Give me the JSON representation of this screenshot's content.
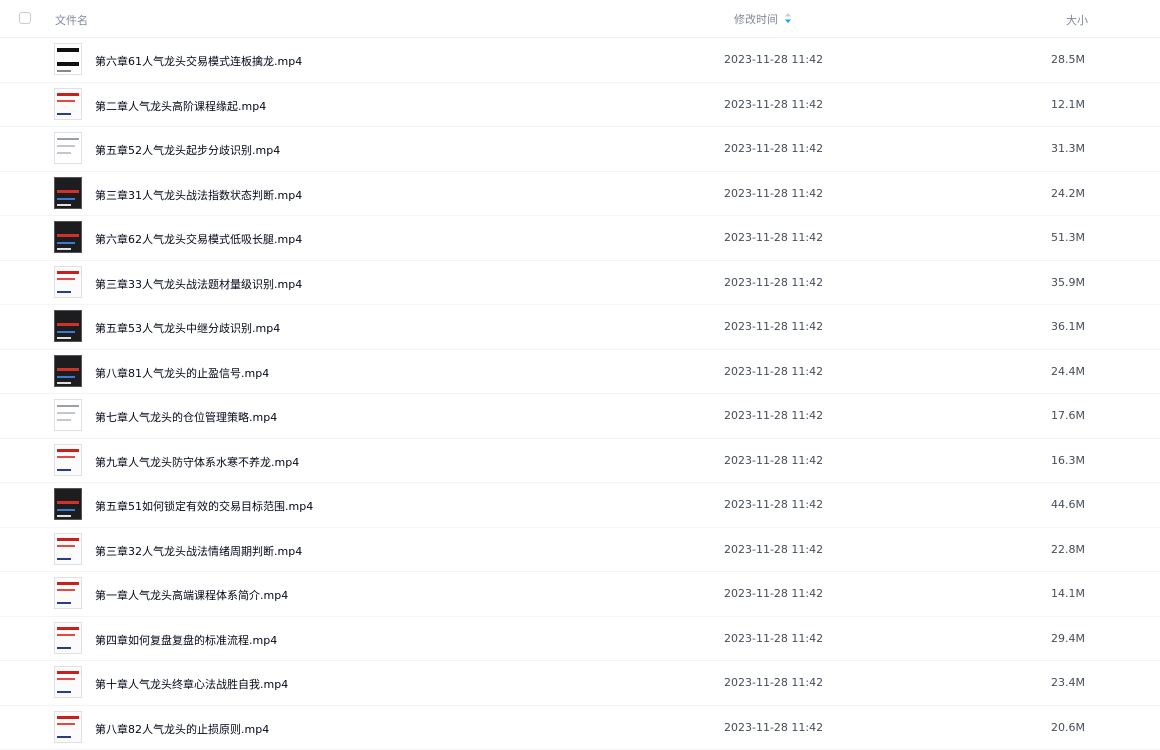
{
  "header": {
    "name_label": "文件名",
    "time_label": "修改时间",
    "size_label": "大小",
    "sort_icon": "sort-desc-icon",
    "accent": "#06a7ff"
  },
  "files": [
    {
      "name": "第六章61人气龙头交易模式连板擒龙.mp4",
      "time": "2023-11-28 11:42",
      "size": "28.5M",
      "thumb": "mixed"
    },
    {
      "name": "第二章人气龙头高阶课程缘起.mp4",
      "time": "2023-11-28 11:42",
      "size": "12.1M",
      "thumb": "red"
    },
    {
      "name": "第五章52人气龙头起步分歧识别.mp4",
      "time": "2023-11-28 11:42",
      "size": "31.3M",
      "thumb": "doc"
    },
    {
      "name": "第三章31人气龙头战法指数状态判断.mp4",
      "time": "2023-11-28 11:42",
      "size": "24.2M",
      "thumb": "dark"
    },
    {
      "name": "第六章62人气龙头交易模式低吸长腿.mp4",
      "time": "2023-11-28 11:42",
      "size": "51.3M",
      "thumb": "dark"
    },
    {
      "name": "第三章33人气龙头战法题材量级识别.mp4",
      "time": "2023-11-28 11:42",
      "size": "35.9M",
      "thumb": "red"
    },
    {
      "name": "第五章53人气龙头中继分歧识别.mp4",
      "time": "2023-11-28 11:42",
      "size": "36.1M",
      "thumb": "dark"
    },
    {
      "name": "第八章81人气龙头的止盈信号.mp4",
      "time": "2023-11-28 11:42",
      "size": "24.4M",
      "thumb": "dark"
    },
    {
      "name": "第七章人气龙头的仓位管理策略.mp4",
      "time": "2023-11-28 11:42",
      "size": "17.6M",
      "thumb": "doc"
    },
    {
      "name": "第九章人气龙头防守体系水寒不养龙.mp4",
      "time": "2023-11-28 11:42",
      "size": "16.3M",
      "thumb": "red"
    },
    {
      "name": "第五章51如何锁定有效的交易目标范围.mp4",
      "time": "2023-11-28 11:42",
      "size": "44.6M",
      "thumb": "dark"
    },
    {
      "name": "第三章32人气龙头战法情绪周期判断.mp4",
      "time": "2023-11-28 11:42",
      "size": "22.8M",
      "thumb": "red"
    },
    {
      "name": "第一章人气龙头高端课程体系简介.mp4",
      "time": "2023-11-28 11:42",
      "size": "14.1M",
      "thumb": "red"
    },
    {
      "name": "第四章如何复盘复盘的标准流程.mp4",
      "time": "2023-11-28 11:42",
      "size": "29.4M",
      "thumb": "red"
    },
    {
      "name": "第十章人气龙头终章心法战胜自我.mp4",
      "time": "2023-11-28 11:42",
      "size": "23.4M",
      "thumb": "red"
    },
    {
      "name": "第八章82人气龙头的止损原则.mp4",
      "time": "2023-11-28 11:42",
      "size": "20.6M",
      "thumb": "red"
    }
  ]
}
